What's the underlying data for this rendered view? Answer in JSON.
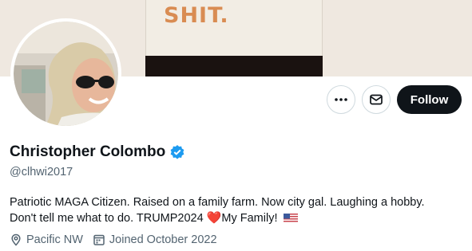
{
  "banner": {
    "text": "SHIT."
  },
  "profile": {
    "name": "Christopher Colombo",
    "handle": "@clhwi2017",
    "bio_line1": "Patriotic MAGA Citizen. Raised on a family farm. Now city gal. Laughing a hobby.",
    "bio_line2_a": "Don't tell me what to do. TRUMP2024 ",
    "heart": "❤️",
    "bio_line2_b": "My Family! ",
    "location": "Pacific NW",
    "joined": "Joined October 2022"
  },
  "actions": {
    "follow_label": "Follow"
  },
  "icons": {
    "more": "more-icon",
    "message": "message-icon",
    "verified": "verified-badge-icon",
    "location": "location-pin-icon",
    "calendar": "calendar-icon",
    "flag": "us-flag-icon"
  },
  "colors": {
    "verified": "#1d9bf0",
    "follow_bg": "#0f1419",
    "secondary_text": "#536471",
    "heart": "#dd2e44"
  }
}
